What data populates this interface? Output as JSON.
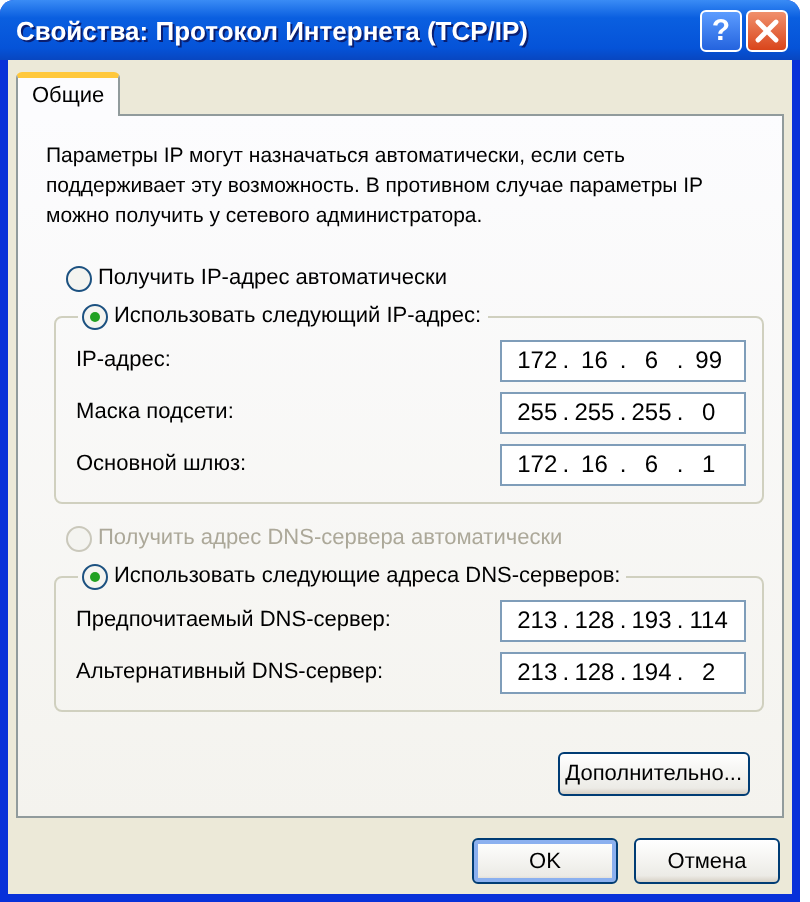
{
  "window": {
    "title": "Свойства: Протокол Интернета (TCP/IP)"
  },
  "title_buttons": [
    {
      "kind": "help",
      "label": "?"
    },
    {
      "kind": "close"
    }
  ],
  "tabs": [
    {
      "label": "Общие",
      "selected": true
    }
  ],
  "description": "Параметры IP могут назначаться автоматически, если сеть поддерживает эту возможность. В противном случае параметры IP можно получить у сетевого администратора.",
  "ip_mode": [
    {
      "label": "Получить IP-адрес автоматически",
      "selected": false,
      "disabled": false
    },
    {
      "label": "Использовать следующий IP-адрес:",
      "selected": true,
      "disabled": false
    }
  ],
  "ip_fields": [
    {
      "label": "IP-адрес:",
      "octets": [
        "172",
        "16",
        "6",
        "99"
      ],
      "separators": [
        ".",
        ".",
        "."
      ]
    },
    {
      "label": "Маска подсети:",
      "octets": [
        "255",
        "255",
        "255",
        "0"
      ],
      "separators": [
        ".",
        ".",
        "."
      ]
    },
    {
      "label": "Основной шлюз:",
      "octets": [
        "172",
        "16",
        "6",
        "1"
      ],
      "separators": [
        ".",
        ".",
        "."
      ]
    }
  ],
  "dns_mode": [
    {
      "label": "Получить адрес DNS-сервера автоматически",
      "selected": false,
      "disabled": true
    },
    {
      "label": "Использовать следующие адреса DNS-серверов:",
      "selected": true,
      "disabled": false
    }
  ],
  "dns_fields": [
    {
      "label": "Предпочитаемый DNS-сервер:",
      "octets": [
        "213",
        "128",
        "193",
        "114"
      ],
      "separators": [
        ".",
        ".",
        "."
      ]
    },
    {
      "label": "Альтернативный DNS-сервер:",
      "octets": [
        "213",
        "128",
        "194",
        "2"
      ],
      "separators": [
        ".",
        ".",
        "."
      ]
    }
  ],
  "advanced_button": "Дополнительно...",
  "buttons": [
    {
      "label": "OK",
      "default": true
    },
    {
      "label": "Отмена",
      "default": false
    }
  ]
}
